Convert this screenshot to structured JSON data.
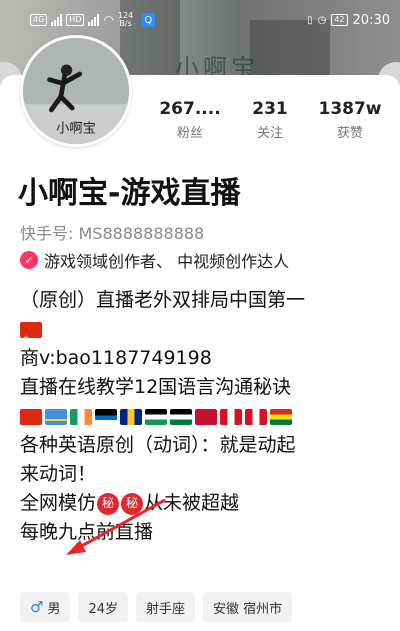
{
  "status_bar": {
    "network_badge_1": "4G",
    "network_badge_2": "HD",
    "net_speed": "124",
    "net_unit": "B/s",
    "battery": "42",
    "time": "20:30"
  },
  "banner": {
    "watermark_text": "小啊宝"
  },
  "avatar": {
    "caption": "小啊宝"
  },
  "stats": [
    {
      "value": "267....",
      "label": "粉丝"
    },
    {
      "value": "231",
      "label": "关注"
    },
    {
      "value": "1387w",
      "label": "获赞"
    }
  ],
  "profile": {
    "name": "小啊宝-游戏直播",
    "kuaishou_id": "快手号: MS8888888888",
    "verified_text": "游戏领域创作者、 中视频创作达人"
  },
  "bio": {
    "line1": "（原创）直播老外双排局中国第一",
    "line2": "商v:bao1187749198",
    "line3": "直播在线教学12国语言沟通秘诀",
    "line4": "各种英语原创（动词）：就是动起",
    "line5": "来动词！",
    "line6_prefix": "全网模仿",
    "secret_badge": "秘",
    "line6_suffix": "从未被超越",
    "line7": "每晚九点前直播"
  },
  "tags": {
    "gender_symbol": "♂",
    "gender": "男",
    "age": "24岁",
    "zodiac": "射手座",
    "location": "安徽 宿州市"
  },
  "colors": {
    "accent_red": "#e0262f",
    "verify_pink": "#fe3666",
    "male_blue": "#2f7bff"
  }
}
